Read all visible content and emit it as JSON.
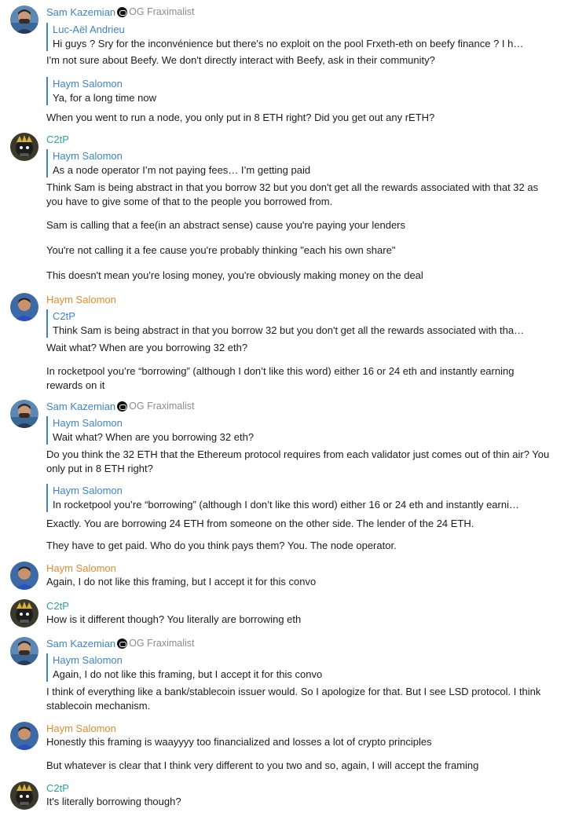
{
  "users": {
    "sam": {
      "name": "Sam Kazemian",
      "tag": "OG Fraximalist"
    },
    "c2tp": {
      "name": "C2tP"
    },
    "haym": {
      "name": "Haym Salomon"
    },
    "luc": {
      "name": "Luc-Aël Andrieu"
    }
  },
  "colors": {
    "sam": "#3d84c6",
    "c2tp": "#2aa59c",
    "haym": "#e6892a",
    "quote_bar": "#3d84c6"
  },
  "m1": {
    "quote_text": "Hi guys ? Sry for the inconvénience but there's no exploit on the pool Frxeth-eth on beefy finance ?  I h…",
    "text": "I'm not sure about Beefy. We don't directly interact with Beefy, ask in their community?",
    "quote2_text": "Ya, for a long time now",
    "text2": "When you went to run a node, you only put in 8 ETH right? Did you get out any rETH?"
  },
  "m2": {
    "quote_text": "As a node operator I’m not paying fees… I’m getting paid",
    "p1": "Think Sam is being abstract in that you borrow 32 but you don't get all the rewards associated with that 32 as you have to give some of that to the people you borrowed from.",
    "p2": "Sam is calling that a fee(in an abstract sense) cause you're paying your lenders",
    "p3": "You're not calling it a fee cause you're probably thinking \"each his own share\"",
    "p4": "This doesn't mean you're losing money, you're obviously making money on the deal"
  },
  "m3": {
    "quote_text": "Think Sam is being abstract in that you borrow 32 but you don't get all the rewards associated with tha…",
    "p1": "Wait what? When are you borrowing 32 eth?",
    "p2": "In rocketpool you’re “borrowing” (although I don’t like this word) either 16 or 24 eth and instantly earning rewards on it"
  },
  "m4": {
    "quote_text": "Wait what? When are you borrowing 32 eth?",
    "p1": "Do you think the 32 ETH that the Ethereum protocol requires from each validator just comes out of thin air? You only put in 8 ETH right?",
    "quote2_text": "In rocketpool you’re “borrowing” (although I don’t like this word) either 16 or 24 eth and instantly earni…",
    "p2": "Exactly. You are borrowing 24 ETH from someone on the other side. The lender of the 24 ETH.",
    "p3": "They have to get paid. Who do you think pays them? You. The node operator."
  },
  "m5": {
    "p1": "Again, I do not like this framing, but I accept it for this convo"
  },
  "m6": {
    "p1": "How is it different though? You literally are borrowing eth"
  },
  "m7": {
    "quote_text": "Again, I do not like this framing, but I accept it for this convo",
    "p1": "I think of everything like a bank/stablecoin issuer would. So I apologize for that. But I see LSD protocol. I think stablecoin mechanism."
  },
  "m8": {
    "p1": "Honestly this framing is waayyyy too financialized and losses a lot of crypto principles",
    "p2": "But whatever is clear that I think very different to you two and so, again, I will accept the framing"
  },
  "m9": {
    "p1": "It's literally borrowing though?"
  }
}
